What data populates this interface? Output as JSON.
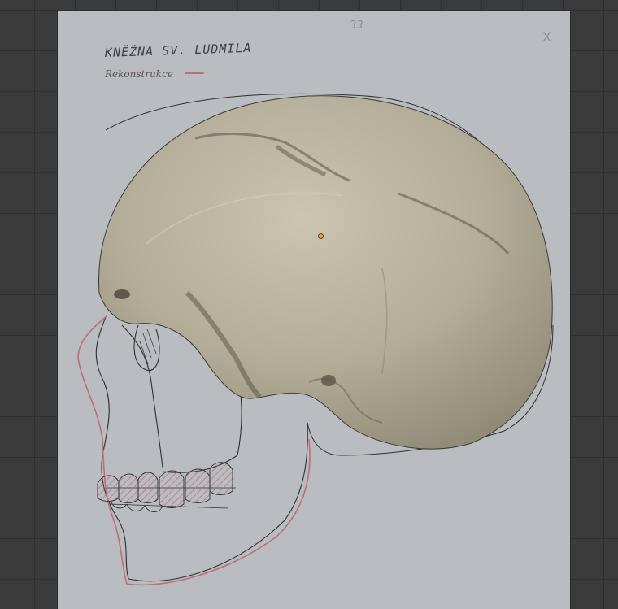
{
  "sheet": {
    "page_number": "33",
    "corner_mark": "X",
    "title": "KNĚŽNA SV. LUDMILA",
    "subtitle": "Rekonstrukce"
  },
  "colors": {
    "grid_background": "#3b3b3b",
    "sheet_background": "#b9bcc0",
    "skull_model": "#b2ab96",
    "reconstruction_line": "#c06b7a",
    "pencil_line": "#2e2f33",
    "origin_point": "#f0a33a"
  },
  "objects": {
    "skull_model": "skull-3d-model",
    "origin_marker": "object-origin"
  }
}
